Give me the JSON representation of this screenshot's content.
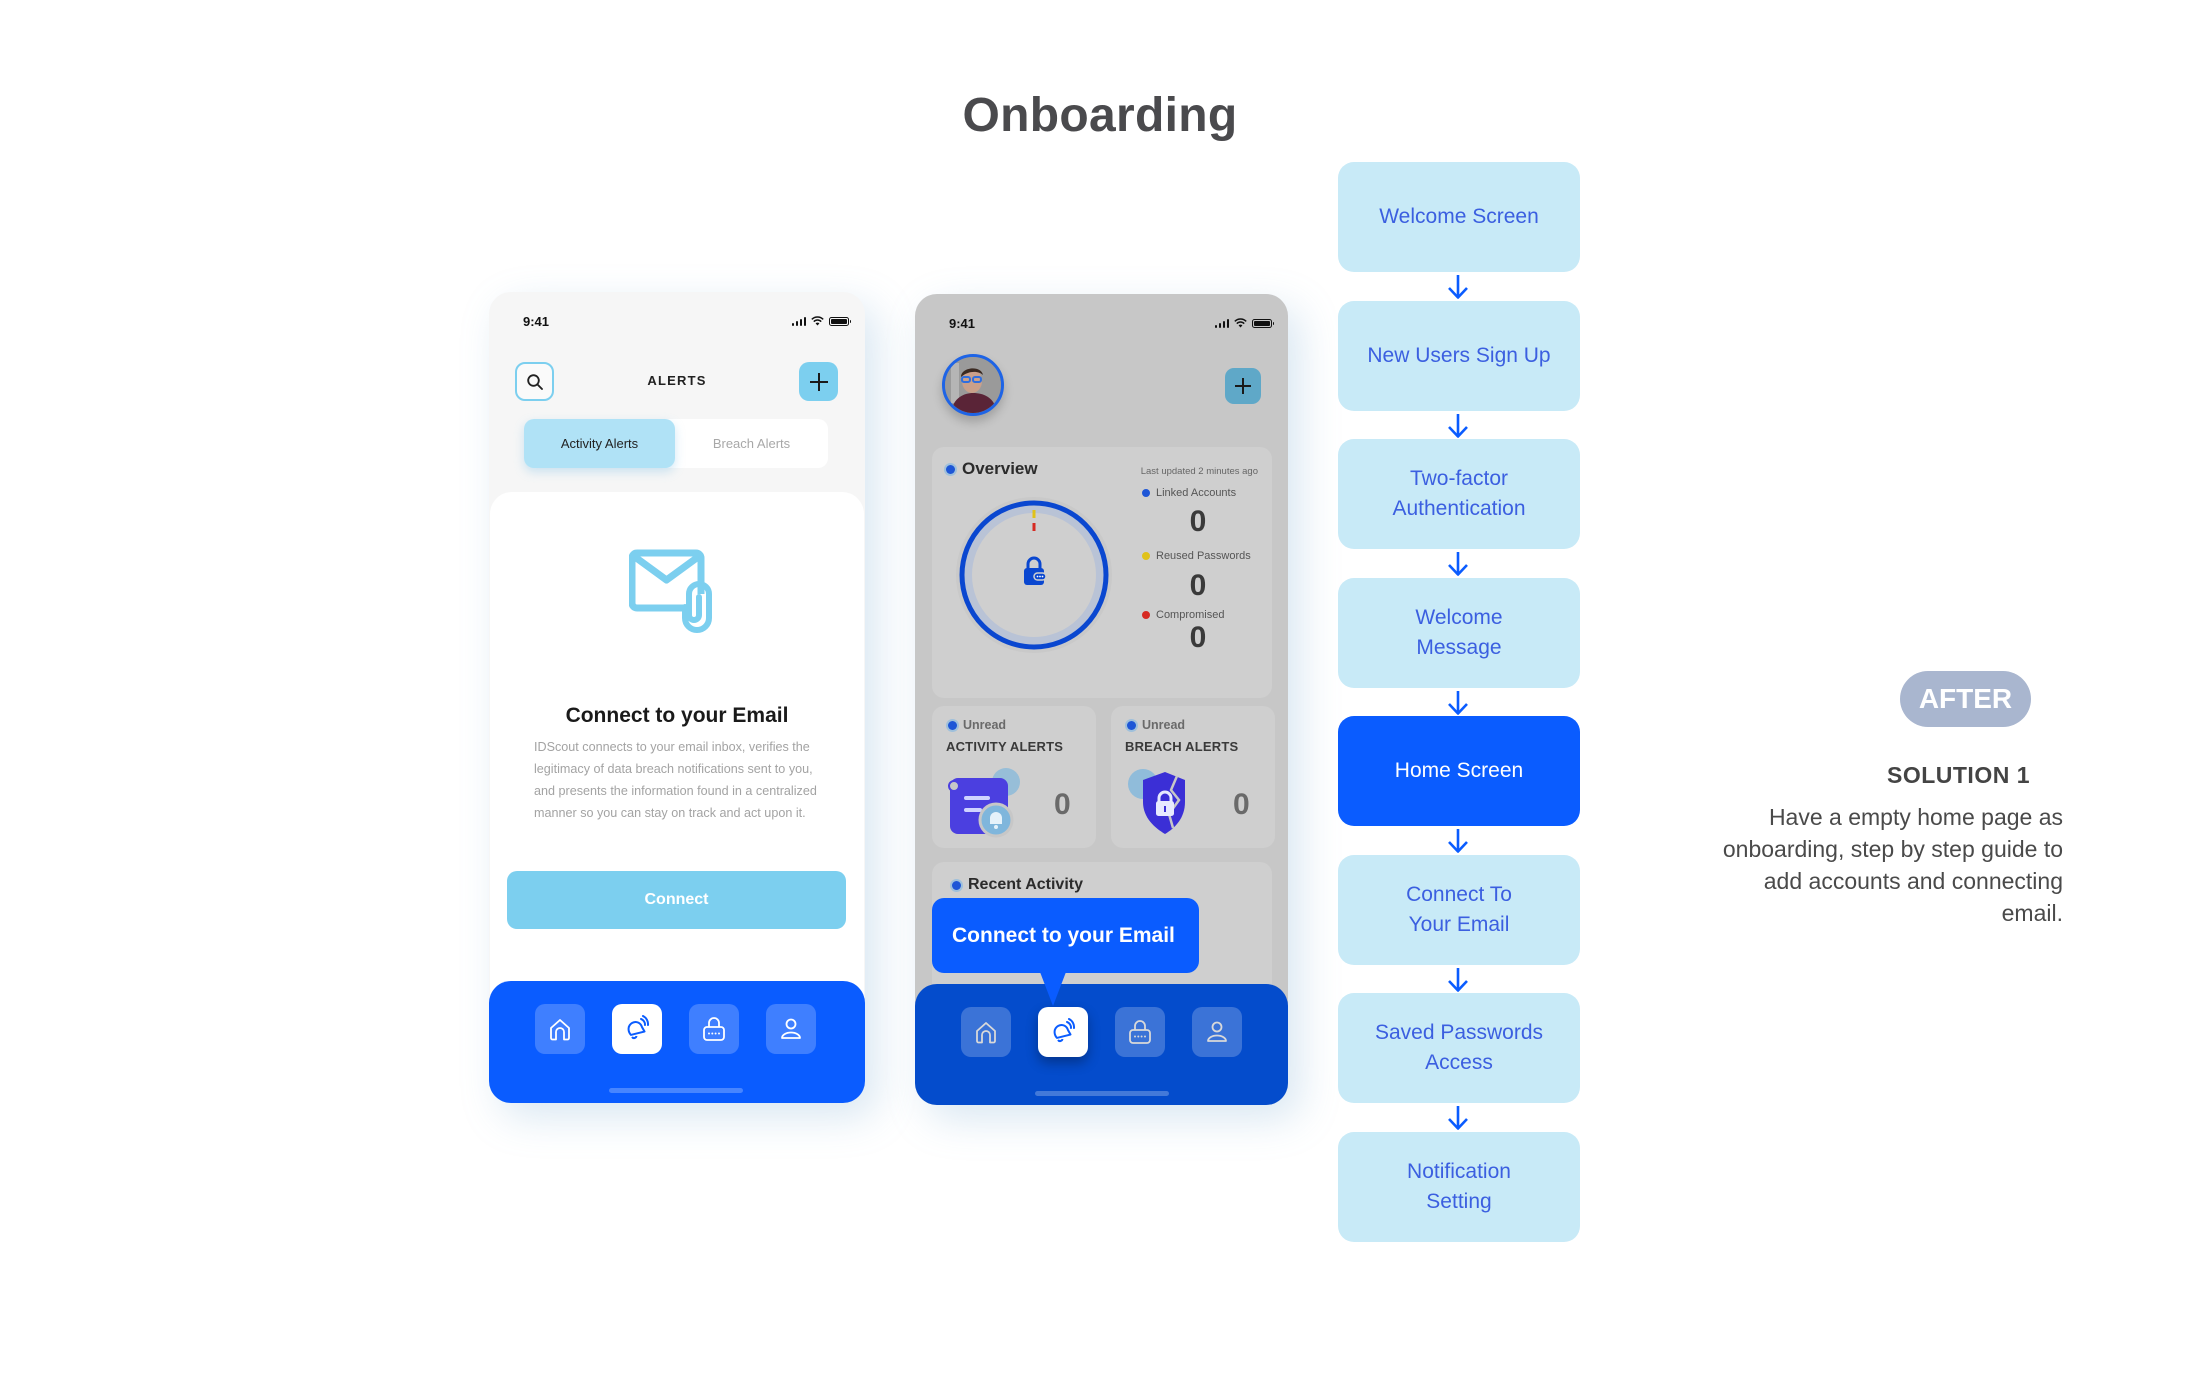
{
  "page": {
    "title": "Onboarding"
  },
  "phone_alerts": {
    "status_time": "9:41",
    "header_title": "ALERTS",
    "search_icon": "search-icon",
    "add_icon": "plus-icon",
    "tabs": [
      {
        "label": "Activity Alerts",
        "active": true
      },
      {
        "label": "Breach Alerts",
        "active": false
      }
    ],
    "card": {
      "icon": "mail-attachment-icon",
      "title": "Connect to your Email",
      "body": "IDScout connects to your email inbox, verifies the legitimacy of data breach notifications sent to you, and presents the information found in a centralized manner so you can stay on track and act upon it.",
      "button_label": "Connect"
    },
    "nav": [
      {
        "icon": "home-icon",
        "active": false
      },
      {
        "icon": "bell-ringing-icon",
        "active": true
      },
      {
        "icon": "password-lock-icon",
        "active": false
      },
      {
        "icon": "user-icon",
        "active": false
      }
    ]
  },
  "phone_home": {
    "status_time": "9:41",
    "overview": {
      "title": "Overview",
      "last_updated": "Last updated 2 minutes ago",
      "stats": [
        {
          "label": "Linked Accounts",
          "value": "0",
          "color": "#1e56d6"
        },
        {
          "label": "Reused Passwords",
          "value": "0",
          "color": "#e0c21a"
        },
        {
          "label": "Compromised",
          "value": "0",
          "color": "#d62a22"
        }
      ]
    },
    "activity_alerts": {
      "unread_label": "Unread",
      "title": "ACTIVITY ALERTS",
      "value": "0"
    },
    "breach_alerts": {
      "unread_label": "Unread",
      "title": "BREACH ALERTS",
      "value": "0"
    },
    "recent_activity_title": "Recent Activity",
    "tooltip": "Connect to your Email",
    "nav": [
      {
        "icon": "home-icon",
        "active": false
      },
      {
        "icon": "bell-ringing-icon",
        "active": true
      },
      {
        "icon": "password-lock-icon",
        "active": false
      },
      {
        "icon": "user-icon",
        "active": false
      }
    ]
  },
  "flow": {
    "steps": [
      {
        "label": "Welcome Screen",
        "current": false
      },
      {
        "label": "New Users Sign Up",
        "current": false
      },
      {
        "label": "Two-factor\nAuthentication",
        "current": false
      },
      {
        "label": "Welcome\nMessage",
        "current": false
      },
      {
        "label": "Home Screen",
        "current": true
      },
      {
        "label": "Connect To\nYour Email",
        "current": false
      },
      {
        "label": "Saved Passwords\nAccess",
        "current": false
      },
      {
        "label": "Notification\nSetting",
        "current": false
      }
    ]
  },
  "solution": {
    "badge": "AFTER",
    "title": "SOLUTION 1",
    "description": "Have a empty home page as onboarding, step by step guide to add accounts and connecting email."
  },
  "colors": {
    "brand_blue": "#0a5cff",
    "light_blue": "#7ccfef",
    "flow_box": "#c8eaf7",
    "flow_text": "#3b5fe0",
    "badge_gray": "#a9b6cf"
  }
}
